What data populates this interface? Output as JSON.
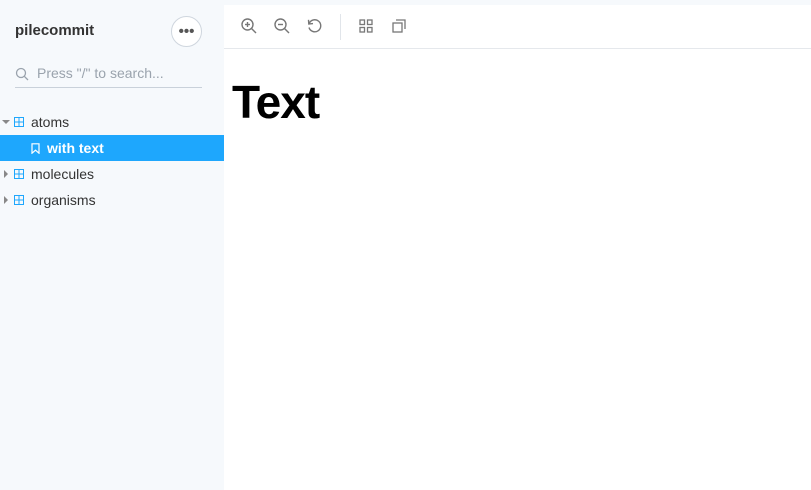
{
  "sidebar": {
    "brand": "pilecommit",
    "menu_glyph": "•••",
    "search_placeholder": "Press \"/\" to search...",
    "items": [
      {
        "label": "atoms",
        "expanded": true
      },
      {
        "label": "with text",
        "selected": true
      },
      {
        "label": "molecules",
        "expanded": false
      },
      {
        "label": "organisms",
        "expanded": false
      }
    ]
  },
  "toolbar": {
    "icons": [
      "zoom-in-icon",
      "zoom-out-icon",
      "reset-zoom-icon",
      "grid-icon",
      "outline-icon"
    ]
  },
  "preview": {
    "heading": "Text"
  },
  "colors": {
    "accent": "#1ea7fd",
    "sidebar_bg": "#f6f9fc",
    "component_icon": "#1ea7fd"
  }
}
